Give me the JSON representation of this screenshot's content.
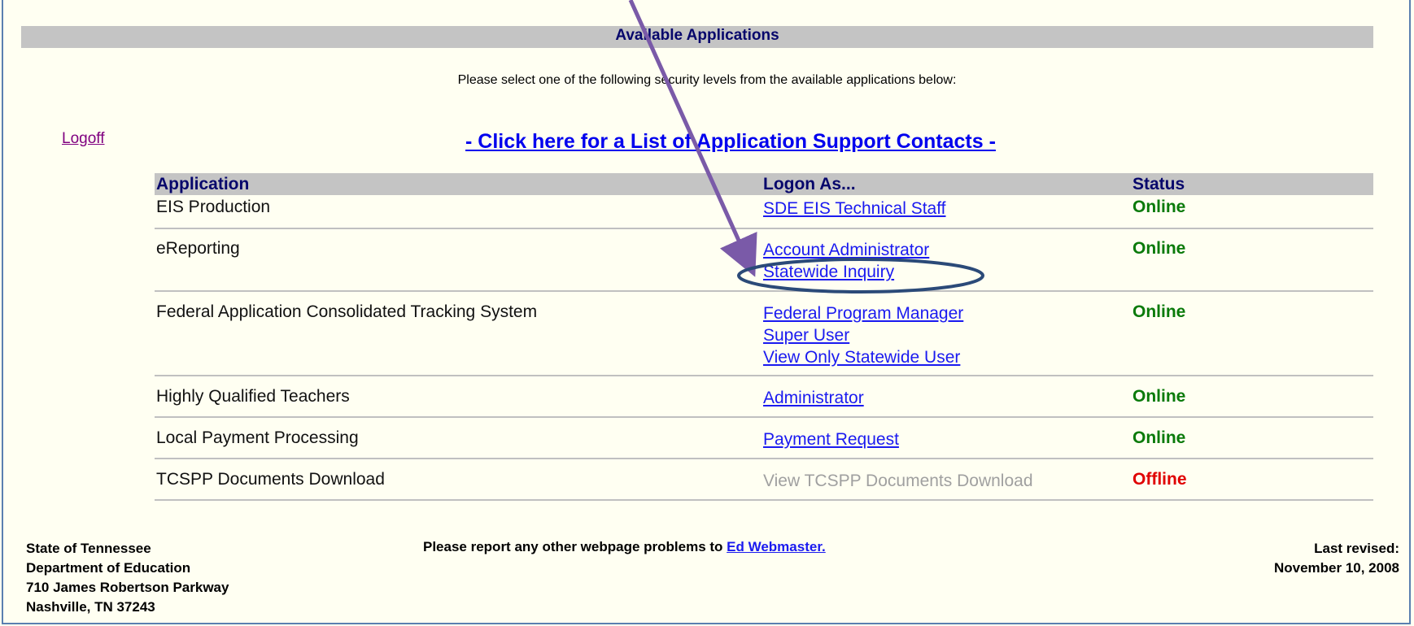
{
  "header": {
    "title": "Available Applications",
    "instructions": "Please select one of the following security levels from the available applications below:"
  },
  "nav": {
    "logoff": "Logoff",
    "contacts_link": "- Click here for a List of Application Support Contacts -"
  },
  "table": {
    "columns": [
      "Application",
      "Logon As...",
      "Status"
    ],
    "rows": [
      {
        "app": "EIS Production",
        "logons": [
          "SDE EIS Technical Staff"
        ],
        "status": "Online"
      },
      {
        "app": "eReporting",
        "logons": [
          "Account Administrator",
          "Statewide Inquiry"
        ],
        "status": "Online"
      },
      {
        "app": "Federal Application Consolidated Tracking System",
        "logons": [
          "Federal Program Manager",
          "Super User",
          "View Only Statewide User"
        ],
        "status": "Online"
      },
      {
        "app": "Highly Qualified Teachers",
        "logons": [
          "Administrator"
        ],
        "status": "Online"
      },
      {
        "app": "Local Payment Processing",
        "logons": [
          "Payment Request"
        ],
        "status": "Online"
      },
      {
        "app": "TCSPP Documents Download",
        "logons": [
          "View TCSPP Documents Download"
        ],
        "status": "Offline"
      }
    ]
  },
  "footer": {
    "address": [
      "State of Tennessee",
      "Department of Education",
      "710 James Robertson Parkway",
      "Nashville, TN 37243"
    ],
    "report_text": "Please report any other webpage problems to ",
    "report_link": "Ed Webmaster.",
    "revised_label": "Last revised:",
    "revised_date": "November 10, 2008"
  },
  "colors": {
    "online": "#0a7a0a",
    "offline": "#e00000",
    "annotation": "#7a5aa8",
    "ellipse": "#2b4a78"
  }
}
